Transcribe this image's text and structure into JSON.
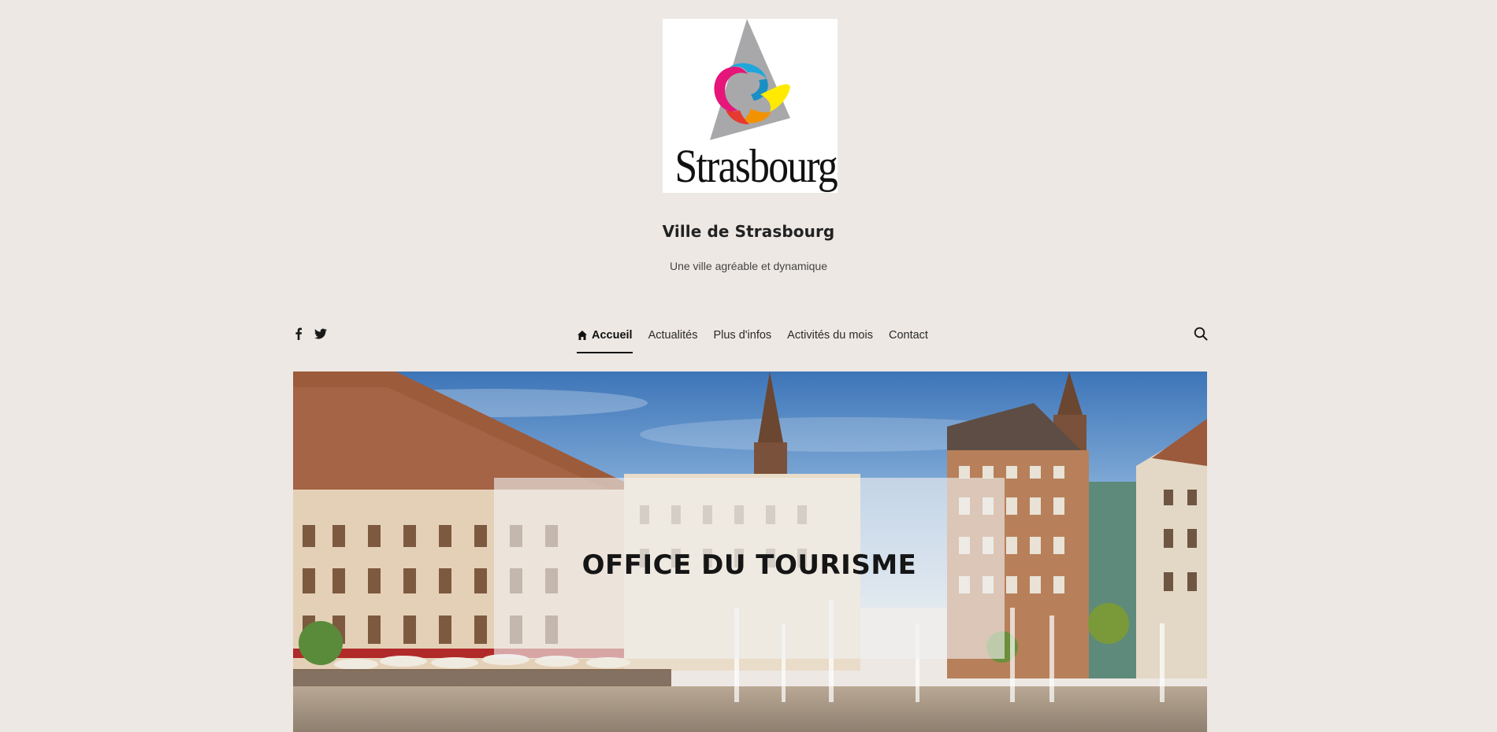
{
  "logo": {
    "wordmark": "Strasbourg",
    "colors": {
      "triangle": "#a8a8aa",
      "magenta": "#e5157a",
      "cyan": "#1fa6dc",
      "yellow": "#ffea00",
      "orange": "#f39200",
      "red": "#e53a2f"
    }
  },
  "site": {
    "title": "Ville de Strasbourg",
    "tagline": "Une ville agréable et dynamique"
  },
  "social": {
    "facebook_icon": "facebook-icon",
    "twitter_icon": "twitter-icon"
  },
  "nav": {
    "items": [
      {
        "label": "Accueil",
        "icon": "home-icon",
        "active": true
      },
      {
        "label": "Actualités"
      },
      {
        "label": "Plus d'infos"
      },
      {
        "label": "Activités du mois"
      },
      {
        "label": "Contact"
      }
    ],
    "search_icon": "search-icon"
  },
  "hero": {
    "title": "OFFICE DU TOURISME"
  },
  "colors": {
    "page_background": "#ede8e4",
    "text": "#1a1a1a",
    "active_underline": "#111111"
  }
}
